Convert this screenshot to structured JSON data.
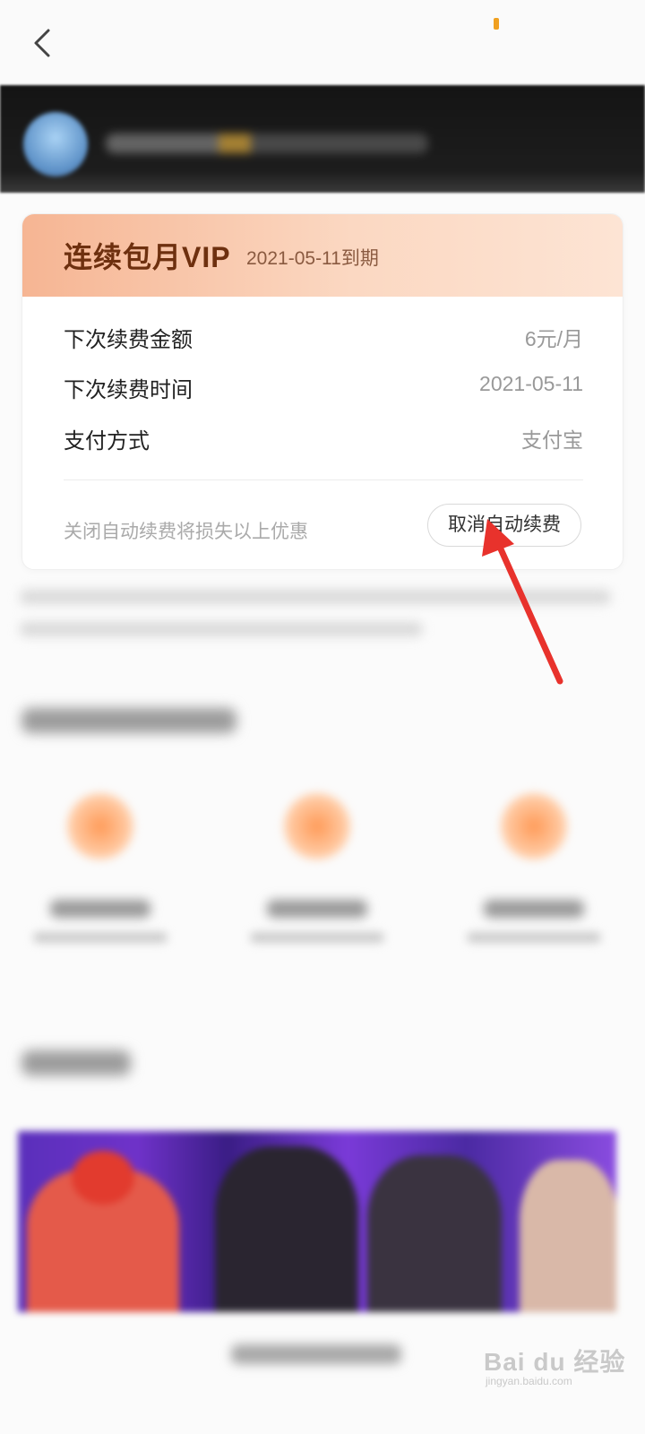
{
  "header": {
    "back_icon": "chevron-left-icon"
  },
  "subscription": {
    "title": "连续包月VIP",
    "expiry": "2021-05-11到期",
    "rows": [
      {
        "label": "下次续费金额",
        "value": "6元/月"
      },
      {
        "label": "下次续费时间",
        "value": "2021-05-11"
      },
      {
        "label": "支付方式",
        "value": "支付宝"
      }
    ],
    "hint": "关闭自动续费将损失以上优惠",
    "cancel_button": "取消自动续费"
  },
  "annotation": {
    "arrow_color": "#e8322c"
  },
  "watermark": {
    "text": "Bai du 经验",
    "sub": "jingyan.baidu.com"
  },
  "colors": {
    "accent": "#6e300f",
    "header_gradient_start": "#f6b593",
    "status_dot": "#f0a020"
  }
}
